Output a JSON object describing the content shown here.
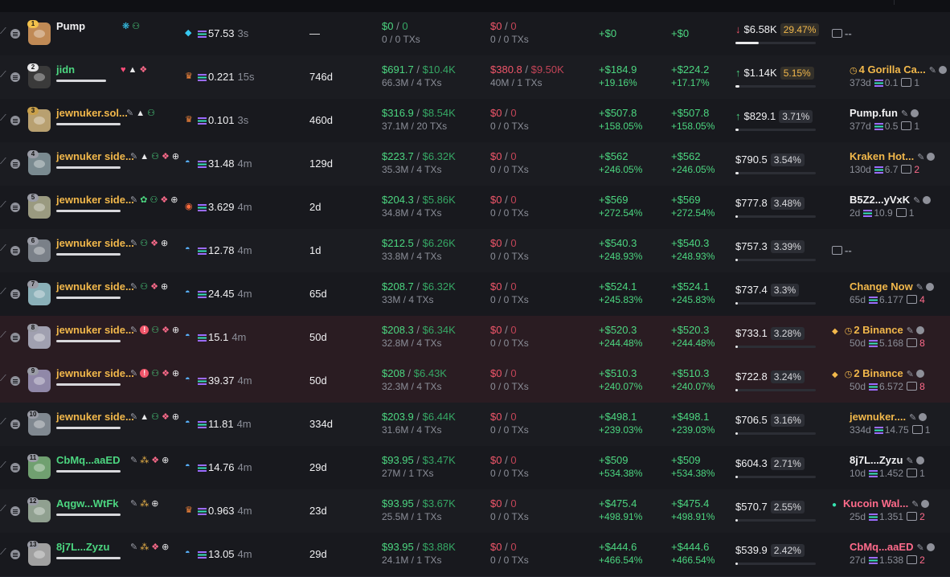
{
  "colors": {
    "profit": "#4cd680",
    "loss": "#f0566a",
    "highlight": "#f2b84b",
    "muted": "#8b8e98"
  },
  "rows": [
    {
      "rank": "1",
      "name": "Pump",
      "name_color": "white",
      "badges": [
        "bubble-icon",
        "users-icon"
      ],
      "sol_icon": "whale-icon",
      "balance": "57.53",
      "balance_time": "3s",
      "age": "—",
      "bought": "$0",
      "bought_total": "0",
      "bought_sub": "0 / 0 TXs",
      "sold": "$0",
      "sold_total": "0",
      "sold_sub": "0 / 0 TXs",
      "upnl": "+$0",
      "upnl_pct": "",
      "pnl": "+$0",
      "pnl_pct": "",
      "holding": "$6.58K",
      "holding_pct": "29.47%",
      "holding_arrow": "↓",
      "holding_progress": 0.29,
      "funding": "--",
      "funding_color": "gray",
      "funding_sub": "",
      "funding_amount": "",
      "funding_count": ""
    },
    {
      "rank": "2",
      "name": "jidn",
      "name_color": "green",
      "badges": [
        "heart-icon",
        "mountain-icon",
        "layers-icon"
      ],
      "sol_icon": "crown-icon",
      "balance": "0.221",
      "balance_time": "15s",
      "age": "746d",
      "bought": "$691.7",
      "bought_total": "$10.4K",
      "bought_sub": "66.3M / 4 TXs",
      "sold": "$380.8",
      "sold_total": "$9.50K",
      "sold_sub": "40M / 1 TXs",
      "upnl": "+$184.9",
      "upnl_pct": "+19.16%",
      "pnl": "+$224.2",
      "pnl_pct": "+17.17%",
      "holding": "$1.14K",
      "holding_pct": "5.15%",
      "holding_arrow": "↑",
      "holding_progress": 0.05,
      "funding": "4 Gorilla Ca...",
      "funding_color": "gold",
      "funding_sub": "373d",
      "funding_amount": "0.1",
      "funding_count": "1"
    },
    {
      "rank": "3",
      "name": "jewnuker.sol...",
      "name_color": "gold",
      "badges": [
        "pencil-icon",
        "mountain-icon",
        "users-icon"
      ],
      "sol_icon": "crown-icon",
      "balance": "0.101",
      "balance_time": "3s",
      "age": "460d",
      "bought": "$316.9",
      "bought_total": "$8.54K",
      "bought_sub": "37.1M / 20 TXs",
      "sold": "$0",
      "sold_total": "0",
      "sold_sub": "0 / 0 TXs",
      "upnl": "+$507.8",
      "upnl_pct": "+158.05%",
      "pnl": "+$507.8",
      "pnl_pct": "+158.05%",
      "holding": "$829.1",
      "holding_pct": "3.71%",
      "holding_arrow": "↑",
      "holding_progress": 0.04,
      "funding": "Pump.fun",
      "funding_color": "white",
      "funding_sub": "377d",
      "funding_amount": "0.5",
      "funding_count": "1"
    },
    {
      "rank": "4",
      "name": "jewnuker side...",
      "name_color": "gold",
      "badges": [
        "pencil-icon",
        "mountain-icon",
        "users-icon",
        "layers-icon",
        "target-icon"
      ],
      "sol_icon": "fish-icon",
      "balance": "31.48",
      "balance_time": "4m",
      "age": "129d",
      "bought": "$223.7",
      "bought_total": "$6.32K",
      "bought_sub": "35.3M / 4 TXs",
      "sold": "$0",
      "sold_total": "0",
      "sold_sub": "0 / 0 TXs",
      "upnl": "+$562",
      "upnl_pct": "+246.05%",
      "pnl": "+$562",
      "pnl_pct": "+246.05%",
      "holding": "$790.5",
      "holding_pct": "3.54%",
      "holding_arrow": "",
      "holding_progress": 0.04,
      "funding": "Kraken Hot...",
      "funding_color": "gold",
      "funding_sub": "130d",
      "funding_amount": "6.7",
      "funding_count": "2"
    },
    {
      "rank": "5",
      "name": "jewnuker side...",
      "name_color": "gold",
      "badges": [
        "pencil-icon",
        "leaf-icon",
        "users-icon",
        "layers-icon",
        "target-icon"
      ],
      "sol_icon": "shell-icon",
      "balance": "3.629",
      "balance_time": "4m",
      "age": "2d",
      "bought": "$204.3",
      "bought_total": "$5.86K",
      "bought_sub": "34.8M / 4 TXs",
      "sold": "$0",
      "sold_total": "0",
      "sold_sub": "0 / 0 TXs",
      "upnl": "+$569",
      "upnl_pct": "+272.54%",
      "pnl": "+$569",
      "pnl_pct": "+272.54%",
      "holding": "$777.8",
      "holding_pct": "3.48%",
      "holding_arrow": "",
      "holding_progress": 0.03,
      "funding": "B5Z2...yVxK",
      "funding_color": "white",
      "funding_sub": "2d",
      "funding_amount": "10.9",
      "funding_count": "1"
    },
    {
      "rank": "6",
      "name": "jewnuker side...",
      "name_color": "gold",
      "badges": [
        "pencil-icon",
        "users-icon",
        "layers-icon",
        "target-icon"
      ],
      "sol_icon": "fish-icon",
      "balance": "12.78",
      "balance_time": "4m",
      "age": "1d",
      "bought": "$212.5",
      "bought_total": "$6.26K",
      "bought_sub": "33.8M / 4 TXs",
      "sold": "$0",
      "sold_total": "0",
      "sold_sub": "0 / 0 TXs",
      "upnl": "+$540.3",
      "upnl_pct": "+248.93%",
      "pnl": "+$540.3",
      "pnl_pct": "+248.93%",
      "holding": "$757.3",
      "holding_pct": "3.39%",
      "holding_arrow": "",
      "holding_progress": 0.03,
      "funding": "--",
      "funding_color": "gray",
      "funding_sub": "",
      "funding_amount": "",
      "funding_count": ""
    },
    {
      "rank": "7",
      "name": "jewnuker side...",
      "name_color": "gold",
      "badges": [
        "pencil-icon",
        "users-icon",
        "layers-icon",
        "target-icon"
      ],
      "sol_icon": "fish-icon",
      "balance": "24.45",
      "balance_time": "4m",
      "age": "65d",
      "bought": "$208.7",
      "bought_total": "$6.32K",
      "bought_sub": "33M / 4 TXs",
      "sold": "$0",
      "sold_total": "0",
      "sold_sub": "0 / 0 TXs",
      "upnl": "+$524.1",
      "upnl_pct": "+245.83%",
      "pnl": "+$524.1",
      "pnl_pct": "+245.83%",
      "holding": "$737.4",
      "holding_pct": "3.3%",
      "holding_arrow": "",
      "holding_progress": 0.03,
      "funding": "Change Now",
      "funding_color": "gold",
      "funding_sub": "65d",
      "funding_amount": "6.177",
      "funding_count": "4"
    },
    {
      "rank": "8",
      "name": "jewnuker side...",
      "name_color": "gold",
      "badges": [
        "pencil-icon",
        "alert-icon",
        "users-icon",
        "layers-icon",
        "target-icon"
      ],
      "sol_icon": "fish-icon",
      "balance": "15.1",
      "balance_time": "4m",
      "age": "50d",
      "bought": "$208.3",
      "bought_total": "$6.34K",
      "bought_sub": "32.8M / 4 TXs",
      "sold": "$0",
      "sold_total": "0",
      "sold_sub": "0 / 0 TXs",
      "upnl": "+$520.3",
      "upnl_pct": "+244.48%",
      "pnl": "+$520.3",
      "pnl_pct": "+244.48%",
      "holding": "$733.1",
      "holding_pct": "3.28%",
      "holding_arrow": "",
      "holding_progress": 0.03,
      "funding": "2 Binance",
      "funding_color": "gold",
      "funding_sub": "50d",
      "funding_amount": "5.168",
      "funding_count": "8"
    },
    {
      "rank": "9",
      "name": "jewnuker side...",
      "name_color": "gold",
      "badges": [
        "pencil-icon",
        "alert-icon",
        "users-icon",
        "layers-icon",
        "target-icon"
      ],
      "sol_icon": "fish-icon",
      "balance": "39.37",
      "balance_time": "4m",
      "age": "50d",
      "bought": "$208",
      "bought_total": "$6.43K",
      "bought_sub": "32.3M / 4 TXs",
      "sold": "$0",
      "sold_total": "0",
      "sold_sub": "0 / 0 TXs",
      "upnl": "+$510.3",
      "upnl_pct": "+240.07%",
      "pnl": "+$510.3",
      "pnl_pct": "+240.07%",
      "holding": "$722.8",
      "holding_pct": "3.24%",
      "holding_arrow": "",
      "holding_progress": 0.03,
      "funding": "2 Binance",
      "funding_color": "gold",
      "funding_sub": "50d",
      "funding_amount": "6.572",
      "funding_count": "8"
    },
    {
      "rank": "10",
      "name": "jewnuker side...",
      "name_color": "gold",
      "badges": [
        "pencil-icon",
        "mountain-icon",
        "users-icon",
        "layers-icon",
        "target-icon"
      ],
      "sol_icon": "fish-icon",
      "balance": "11.81",
      "balance_time": "4m",
      "age": "334d",
      "bought": "$203.9",
      "bought_total": "$6.44K",
      "bought_sub": "31.6M / 4 TXs",
      "sold": "$0",
      "sold_total": "0",
      "sold_sub": "0 / 0 TXs",
      "upnl": "+$498.1",
      "upnl_pct": "+239.03%",
      "pnl": "+$498.1",
      "pnl_pct": "+239.03%",
      "holding": "$706.5",
      "holding_pct": "3.16%",
      "holding_arrow": "",
      "holding_progress": 0.03,
      "funding": "jewnuker....",
      "funding_color": "gold",
      "funding_sub": "334d",
      "funding_amount": "14.75",
      "funding_count": "1"
    },
    {
      "rank": "11",
      "name": "CbMq...aaED",
      "name_color": "green",
      "badges": [
        "pencil-icon",
        "group-icon",
        "layers-icon",
        "target-icon"
      ],
      "sol_icon": "fish-icon",
      "balance": "14.76",
      "balance_time": "4m",
      "age": "29d",
      "bought": "$93.95",
      "bought_total": "$3.47K",
      "bought_sub": "27M / 1 TXs",
      "sold": "$0",
      "sold_total": "0",
      "sold_sub": "0 / 0 TXs",
      "upnl": "+$509",
      "upnl_pct": "+534.38%",
      "pnl": "+$509",
      "pnl_pct": "+534.38%",
      "holding": "$604.3",
      "holding_pct": "2.71%",
      "holding_arrow": "",
      "holding_progress": 0.03,
      "funding": "8j7L...Zyzu",
      "funding_color": "white",
      "funding_sub": "10d",
      "funding_amount": "1.452",
      "funding_count": "1"
    },
    {
      "rank": "12",
      "name": "Aqgw...WtFk",
      "name_color": "green",
      "badges": [
        "pencil-icon",
        "group-icon",
        "target-icon"
      ],
      "sol_icon": "crown-icon",
      "balance": "0.963",
      "balance_time": "4m",
      "age": "23d",
      "bought": "$93.95",
      "bought_total": "$3.67K",
      "bought_sub": "25.5M / 1 TXs",
      "sold": "$0",
      "sold_total": "0",
      "sold_sub": "0 / 0 TXs",
      "upnl": "+$475.4",
      "upnl_pct": "+498.91%",
      "pnl": "+$475.4",
      "pnl_pct": "+498.91%",
      "holding": "$570.7",
      "holding_pct": "2.55%",
      "holding_arrow": "",
      "holding_progress": 0.03,
      "funding": "Kucoin Wal...",
      "funding_color": "pink",
      "funding_sub": "25d",
      "funding_amount": "1.351",
      "funding_count": "2"
    },
    {
      "rank": "13",
      "name": "8j7L...Zyzu",
      "name_color": "green",
      "badges": [
        "pencil-icon",
        "group-icon",
        "layers-icon",
        "target-icon"
      ],
      "sol_icon": "fish-icon",
      "balance": "13.05",
      "balance_time": "4m",
      "age": "29d",
      "bought": "$93.95",
      "bought_total": "$3.88K",
      "bought_sub": "24.1M / 1 TXs",
      "sold": "$0",
      "sold_total": "0",
      "sold_sub": "0 / 0 TXs",
      "upnl": "+$444.6",
      "upnl_pct": "+466.54%",
      "pnl": "+$444.6",
      "pnl_pct": "+466.54%",
      "holding": "$539.9",
      "holding_pct": "2.42%",
      "holding_arrow": "",
      "holding_progress": 0.02,
      "funding": "CbMq...aaED",
      "funding_color": "pink",
      "funding_sub": "27d",
      "funding_amount": "1.538",
      "funding_count": "2"
    }
  ]
}
